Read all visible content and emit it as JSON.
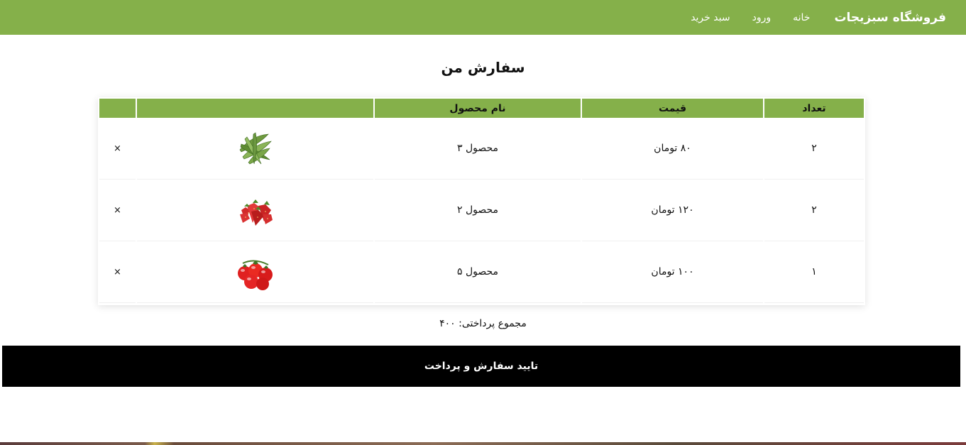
{
  "navbar": {
    "brand": "فروشگاه سبزیجات",
    "links": [
      "خانه",
      "ورود",
      "سبد خرید"
    ],
    "color": "#85b04a"
  },
  "page_title": "سفارش من",
  "table": {
    "headers": {
      "qty": "تعداد",
      "price": "قیمت",
      "name": "نام محصول",
      "image": "",
      "remove": ""
    },
    "rows": [
      {
        "qty": "۲",
        "price": "۸۰ تومان",
        "name": "محصول ۳",
        "image_icon": "okra-icon",
        "remove": "×"
      },
      {
        "qty": "۲",
        "price": "۱۲۰ تومان",
        "name": "محصول ۲",
        "image_icon": "strawberry-icon",
        "remove": "×"
      },
      {
        "qty": "۱",
        "price": "۱۰۰ تومان",
        "name": "محصول ۵",
        "image_icon": "tomato-icon",
        "remove": "×"
      }
    ]
  },
  "total": "مجموع پرداختی: ۴۰۰",
  "checkout_label": "تایید سفارش و پرداخت"
}
